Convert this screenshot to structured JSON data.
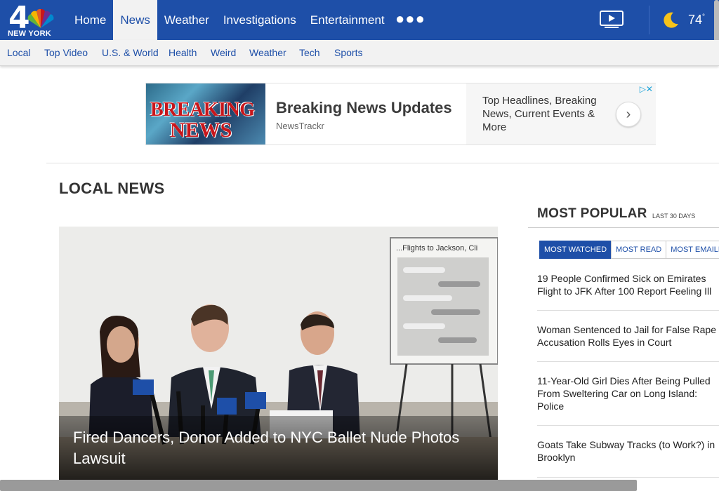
{
  "header": {
    "logo": {
      "channel": "4",
      "city": "NEW YORK"
    },
    "nav": [
      {
        "label": "Home",
        "active": false
      },
      {
        "label": "News",
        "active": true
      },
      {
        "label": "Weather",
        "active": false
      },
      {
        "label": "Investigations",
        "active": false
      },
      {
        "label": "Entertainment",
        "active": false
      }
    ],
    "more_icon": "more-dots-icon",
    "video_icon": "video-play-icon",
    "weather": {
      "icon": "moon-icon",
      "temp": "74",
      "degree": "°"
    }
  },
  "subnav": [
    "Local",
    "Top Video",
    "U.S. & World",
    "Health",
    "Weird",
    "Weather",
    "Tech",
    "Sports"
  ],
  "ad": {
    "image_text_1": "BREAKING",
    "image_text_2": "NEWS",
    "title": "Breaking News Updates",
    "source": "NewsTrackr",
    "description": "Top Headlines, Breaking News, Current Events & More",
    "arrow": "›"
  },
  "section_title": "LOCAL NEWS",
  "hero": {
    "title": "Fired Dancers, Donor Added to NYC Ballet Nude Photos Lawsuit",
    "board_caption": "...Flights to Jackson, Cli"
  },
  "popular": {
    "title": "MOST POPULAR",
    "subtitle": "LAST 30 DAYS",
    "tabs": [
      {
        "label": "MOST WATCHED",
        "active": true
      },
      {
        "label": "MOST READ",
        "active": false
      },
      {
        "label": "MOST EMAILED",
        "active": false
      }
    ],
    "items": [
      {
        "line1": "19 People Confirmed Sick on Emirates",
        "line2": "Flight to JFK After 100 Report Feeling Ill",
        "line3": ""
      },
      {
        "line1": "Woman Sentenced to Jail for False Rape",
        "line2": "Accusation Rolls Eyes in Court",
        "line3": ""
      },
      {
        "line1": "11-Year-Old Girl Dies After Being Pulled",
        "line2": "From Sweltering Car on Long Island:",
        "line3": "Police"
      },
      {
        "line1": "Goats Take Subway Tracks (to Work?) in",
        "line2": "Brooklyn",
        "line3": ""
      }
    ]
  },
  "colors": {
    "brand": "#1e4fa8",
    "subnav_bg": "#f2f2f2"
  }
}
